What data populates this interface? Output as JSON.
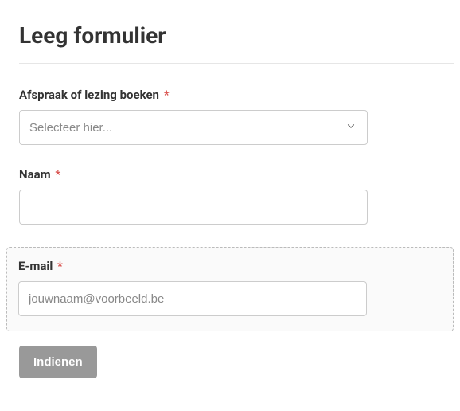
{
  "title": "Leeg formulier",
  "fields": {
    "booking": {
      "label": "Afspraak of lezing boeken",
      "placeholder": "Selecteer hier...",
      "required": "*"
    },
    "name": {
      "label": "Naam",
      "required": "*"
    },
    "email": {
      "label": "E-mail",
      "placeholder": "jouwnaam@voorbeeld.be",
      "required": "*"
    }
  },
  "submit_label": "Indienen"
}
